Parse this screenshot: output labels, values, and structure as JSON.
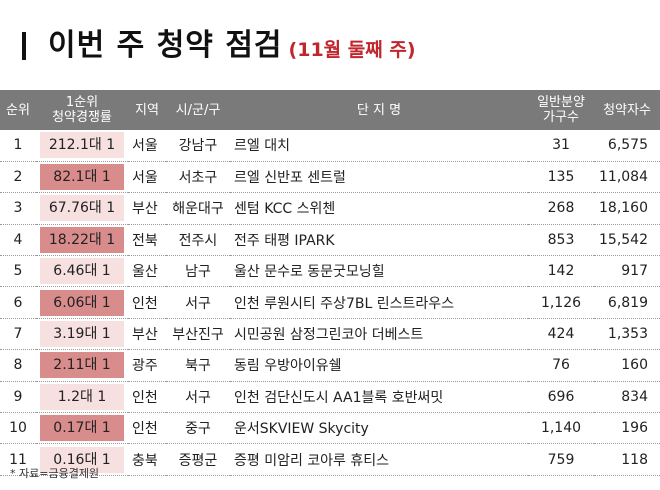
{
  "title": {
    "main": "이번 주 청약 점검",
    "sub": "(11월 둘째 주)"
  },
  "headers": {
    "rank": "순위",
    "rate_line1": "1순위",
    "rate_line2": "청약경쟁률",
    "region": "지역",
    "city": "시/군/구",
    "name": "단 지 명",
    "units_line1": "일반분양",
    "units_line2": "가구수",
    "apps": "청약자수"
  },
  "rows": [
    {
      "rank": "1",
      "rate": "212.1대 1",
      "region": "서울",
      "city": "강남구",
      "name": "르엘 대치",
      "units": "31",
      "apps": "6,575",
      "shade": "#f7e0e0"
    },
    {
      "rank": "2",
      "rate": "82.1대 1",
      "region": "서울",
      "city": "서초구",
      "name": "르엘 신반포 센트럴",
      "units": "135",
      "apps": "11,084",
      "shade": "#d98c8c"
    },
    {
      "rank": "3",
      "rate": "67.76대 1",
      "region": "부산",
      "city": "해운대구",
      "name": "센텀 KCC 스위첸",
      "units": "268",
      "apps": "18,160",
      "shade": "#f7e0e0"
    },
    {
      "rank": "4",
      "rate": "18.22대 1",
      "region": "전북",
      "city": "전주시",
      "name": "전주 태평 IPARK",
      "units": "853",
      "apps": "15,542",
      "shade": "#d98c8c"
    },
    {
      "rank": "5",
      "rate": "6.46대 1",
      "region": "울산",
      "city": "남구",
      "name": "울산 문수로 동문굿모닝힐",
      "units": "142",
      "apps": "917",
      "shade": "#f7e0e0"
    },
    {
      "rank": "6",
      "rate": "6.06대 1",
      "region": "인천",
      "city": "서구",
      "name": "인천 루원시티 주상7BL 린스트라우스",
      "units": "1,126",
      "apps": "6,819",
      "shade": "#d98c8c"
    },
    {
      "rank": "7",
      "rate": "3.19대 1",
      "region": "부산",
      "city": "부산진구",
      "name": "시민공원 삼정그린코아 더베스트",
      "units": "424",
      "apps": "1,353",
      "shade": "#f7e0e0"
    },
    {
      "rank": "8",
      "rate": "2.11대 1",
      "region": "광주",
      "city": "북구",
      "name": "동림 우방아이유쉘",
      "units": "76",
      "apps": "160",
      "shade": "#d98c8c"
    },
    {
      "rank": "9",
      "rate": "1.2대 1",
      "region": "인천",
      "city": "서구",
      "name": "인천 검단신도시 AA1블록 호반써밋",
      "units": "696",
      "apps": "834",
      "shade": "#f7e0e0"
    },
    {
      "rank": "10",
      "rate": "0.17대 1",
      "region": "인천",
      "city": "중구",
      "name": "운서SKVIEW Skycity",
      "units": "1,140",
      "apps": "196",
      "shade": "#d98c8c"
    },
    {
      "rank": "11",
      "rate": "0.16대 1",
      "region": "충북",
      "city": "증평군",
      "name": "증평 미암리 코아루 휴티스",
      "units": "759",
      "apps": "118",
      "shade": "#f7e0e0"
    }
  ],
  "note": "* 자료=금융결제원"
}
